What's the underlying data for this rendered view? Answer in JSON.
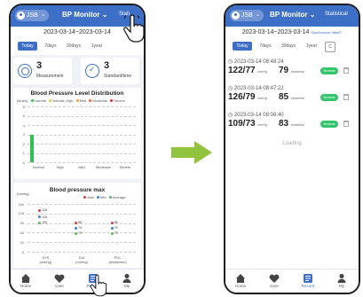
{
  "colors": {
    "brand": "#3d6fc6",
    "status_normal": "#34c46a",
    "arrow": "#92c33c",
    "normal": "#2fbf55",
    "normal_high": "#e6d33b",
    "mild": "#f4a13a",
    "moderate": "#ee6a3b",
    "severe": "#d8303a",
    "max": "#e03b3b",
    "min": "#3b7ee0",
    "average": "#5bb95f"
  },
  "left_screen": {
    "header": {
      "user": "JSB",
      "title": "BP Monitor",
      "statistical": "Stati"
    },
    "date_range": "2023-03-14~2023-03-14",
    "tabs": [
      {
        "label": "Today",
        "active": true
      },
      {
        "label": "7days"
      },
      {
        "label": "30days"
      },
      {
        "label": "1year"
      }
    ],
    "summary": [
      {
        "value": "3",
        "label": "Measurement",
        "icon": "target-icon"
      },
      {
        "value": "3",
        "label": "Standard/time",
        "icon": "check-circle-icon"
      }
    ],
    "charts": [
      {
        "type": "bar",
        "title": "Blood Pressure Level Distribution",
        "unit": "(times)",
        "legend": [
          "Normal",
          "Normal- High",
          "Mild",
          "Moderate",
          "Severe"
        ],
        "categories": [
          "Normal",
          "High",
          "Mild",
          "Moderate",
          "Severe"
        ],
        "values": [
          3,
          0,
          0,
          0,
          0
        ],
        "yticks": [
          "6",
          "5",
          "4",
          "3",
          "2",
          "1",
          "0"
        ],
        "ylim": [
          0,
          6
        ]
      },
      {
        "type": "scatter",
        "title": "Blood pressure max",
        "unit": "(mmhg)",
        "legend": [
          "Max",
          "Min",
          "Average"
        ],
        "categories": [
          "SYS\n(mmhg)",
          "DIA\n(mmhg)",
          "PUL\n(beats/min)"
        ],
        "yticks": [
          "160",
          "128",
          "96",
          "64",
          "32",
          "0"
        ],
        "ylim": [
          0,
          160
        ],
        "series": [
          {
            "name": "Max",
            "values": [
              126,
              85,
              85
            ]
          },
          {
            "name": "Min",
            "values": [
              116,
              79,
              79
            ]
          },
          {
            "name": "Average",
            "values": [
              109,
              73,
              73
            ]
          }
        ]
      }
    ],
    "nav": [
      {
        "label": "Home",
        "icon": "home-icon"
      },
      {
        "label": "Care",
        "icon": "heart-icon"
      },
      {
        "label": "Record",
        "icon": "record-icon",
        "active": true
      },
      {
        "label": "My",
        "icon": "person-icon"
      }
    ]
  },
  "right_screen": {
    "header": {
      "user": "JSB",
      "title": "BP Monitor",
      "statistical": "Statistical"
    },
    "date_range": "2023-03-14~2023-03-14",
    "date_note": "Synchronize data/C",
    "tabs": [
      {
        "label": "Today",
        "active": true
      },
      {
        "label": "7days"
      },
      {
        "label": "30days"
      },
      {
        "label": "1year"
      },
      {
        "label": "C"
      }
    ],
    "records": [
      {
        "time": "2023-03-14 08:48:24",
        "bp": "122/77",
        "bp_unit": "mmHg",
        "pulse": "79",
        "pulse_unit": "beats/min",
        "status": "Normal"
      },
      {
        "time": "2023-03-14 08:47:22",
        "bp": "126/79",
        "bp_unit": "mmHg",
        "pulse": "85",
        "pulse_unit": "beats/min",
        "status": "Normal"
      },
      {
        "time": "2023-03-14 08:08:40",
        "bp": "109/73",
        "bp_unit": "mmHg",
        "pulse": "83",
        "pulse_unit": "beats/min",
        "status": "Normal"
      }
    ],
    "loading": "Loading",
    "nav": [
      {
        "label": "Home",
        "icon": "home-icon"
      },
      {
        "label": "Care",
        "icon": "heart-icon"
      },
      {
        "label": "Record",
        "icon": "record-icon",
        "active": true
      },
      {
        "label": "My",
        "icon": "person-icon"
      }
    ]
  },
  "chart_data": [
    {
      "type": "bar",
      "title": "Blood Pressure Level Distribution",
      "categories": [
        "Normal",
        "High",
        "Mild",
        "Moderate",
        "Severe"
      ],
      "values": [
        3,
        0,
        0,
        0,
        0
      ],
      "ylabel": "(times)",
      "ylim": [
        0,
        6
      ]
    },
    {
      "type": "scatter",
      "title": "Blood pressure max",
      "categories": [
        "SYS (mmhg)",
        "DIA (mmhg)",
        "PUL (beats/min)"
      ],
      "series": [
        {
          "name": "Max",
          "values": [
            126,
            85,
            85
          ]
        },
        {
          "name": "Min",
          "values": [
            116,
            79,
            79
          ]
        },
        {
          "name": "Average",
          "values": [
            109,
            73,
            73
          ]
        }
      ],
      "ylabel": "(mmhg)",
      "ylim": [
        0,
        160
      ]
    }
  ]
}
